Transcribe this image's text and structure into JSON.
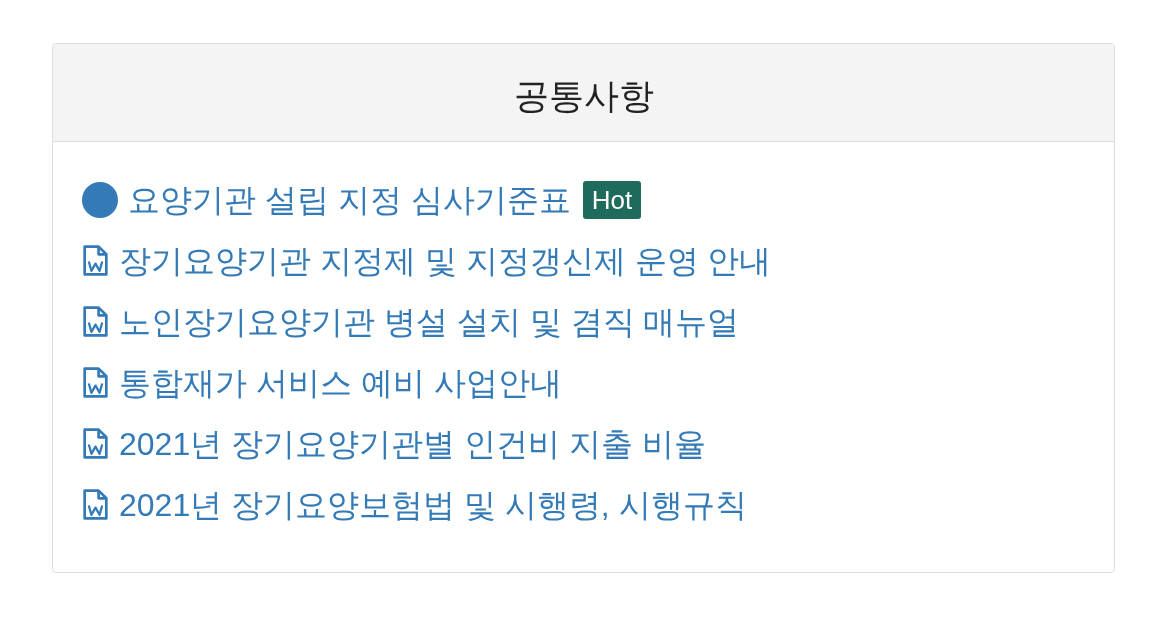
{
  "panel": {
    "title": "공통사항",
    "items": [
      {
        "kind": "dot",
        "label": "요양기관 설립 지정 심사기준표",
        "badge": "Hot"
      },
      {
        "kind": "doc",
        "label": "장기요양기관 지정제 및 지정갱신제 운영 안내"
      },
      {
        "kind": "doc",
        "label": "노인장기요양기관 병설 설치 및 겸직 매뉴얼"
      },
      {
        "kind": "doc",
        "label": "통합재가 서비스 예비 사업안내"
      },
      {
        "kind": "doc",
        "label": "2021년 장기요양기관별 인건비 지출 비율"
      },
      {
        "kind": "doc",
        "label": "2021년 장기요양보험법 및 시행령, 시행규칙"
      }
    ]
  }
}
